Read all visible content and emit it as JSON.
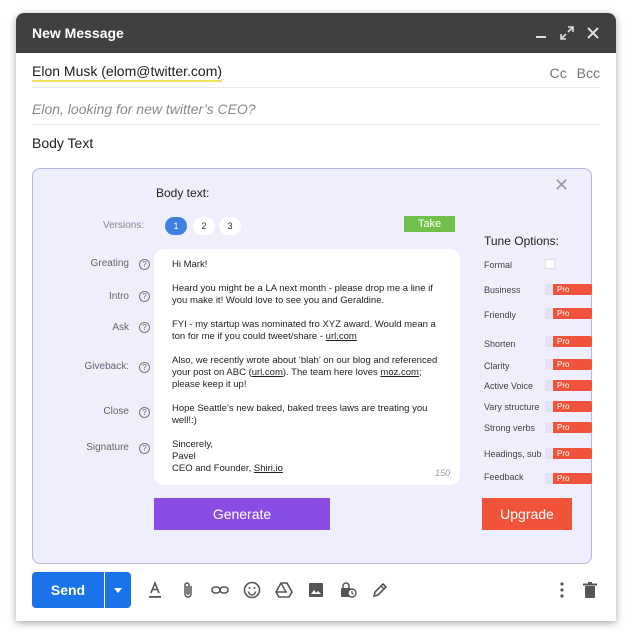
{
  "window": {
    "title": "New Message",
    "controls": [
      "minimize-icon",
      "expand-icon",
      "close-icon"
    ]
  },
  "to": {
    "chip": "Elon Musk  (elom@twitter.com)",
    "cc": "Cc",
    "bcc": "Bcc"
  },
  "subject": "Elon, looking for new twitter’s CEO?",
  "body_text": "Body Text",
  "panel": {
    "close_glyph": "✕",
    "heading": "Body text:",
    "versions_label": "Versions:",
    "versions": [
      "1",
      "2",
      "3"
    ],
    "active_version": "1",
    "take_label": "Take",
    "sections": [
      "Greating",
      "Intro",
      "Ask",
      "Giveback:",
      "Close",
      "Signature"
    ],
    "help_glyph": "?",
    "email": {
      "greeting": "Hi Mark!",
      "intro": "Heard you might be a LA next month - please drop me a line if you make it! Would love to see you and Geraldine.",
      "ask_prefix": "FYI - my startup was nominated fro XYZ award. Would mean a ton for me if you could tweet/share - ",
      "ask_link": "url.com",
      "giveback_prefix": "Also, we recently wrote about ‘blah’ on our blog and referenced your post on ABC (",
      "giveback_link1": "url.com",
      "giveback_mid": "). The team here loves ",
      "giveback_link2": "moz.com",
      "giveback_suffix": "; please keep it up!",
      "close": "Hope Seattle’s new baked, baked trees laws are treating you well!:)",
      "sign_1": "Sincerely,",
      "sign_2": "Pavel",
      "sign_3_prefix": "CEO and Founder, ",
      "sign_3_link": "Shiri.io",
      "char_count": "150"
    },
    "generate_label": "Generate",
    "upgrade_label": "Upgrade",
    "tune_title": "Tune Options:",
    "pro_label": "Pro",
    "options": [
      {
        "label": "Formal",
        "kind": "checkbox"
      },
      {
        "label": "Business",
        "kind": "pro"
      },
      {
        "label": "Friendly",
        "kind": "pro"
      },
      {
        "label": "Shorten",
        "kind": "pro"
      },
      {
        "label": "Clarity",
        "kind": "pro"
      },
      {
        "label": "Active Voice",
        "kind": "pro"
      },
      {
        "label": "Vary structure",
        "kind": "pro"
      },
      {
        "label": "Strong verbs",
        "kind": "pro"
      },
      {
        "label": "Headings, sub",
        "kind": "pro"
      },
      {
        "label": "Feedback",
        "kind": "pro"
      }
    ]
  },
  "toolbar": {
    "send_label": "Send",
    "tools": [
      "format-text-icon",
      "attach-icon",
      "link-icon",
      "emoji-icon",
      "drive-icon",
      "photo-icon",
      "confidential-icon",
      "signature-icon"
    ],
    "right_tools": [
      "more-options-icon",
      "trash-icon"
    ]
  },
  "colors": {
    "titlebar": "#404040",
    "panel_bg": "#eeeefc",
    "take": "#71c04a",
    "generate": "#8a4de3",
    "upgrade": "#f0533a",
    "pro": "#f0533a",
    "send": "#1a73e8",
    "active_version": "#3f7fe0"
  }
}
